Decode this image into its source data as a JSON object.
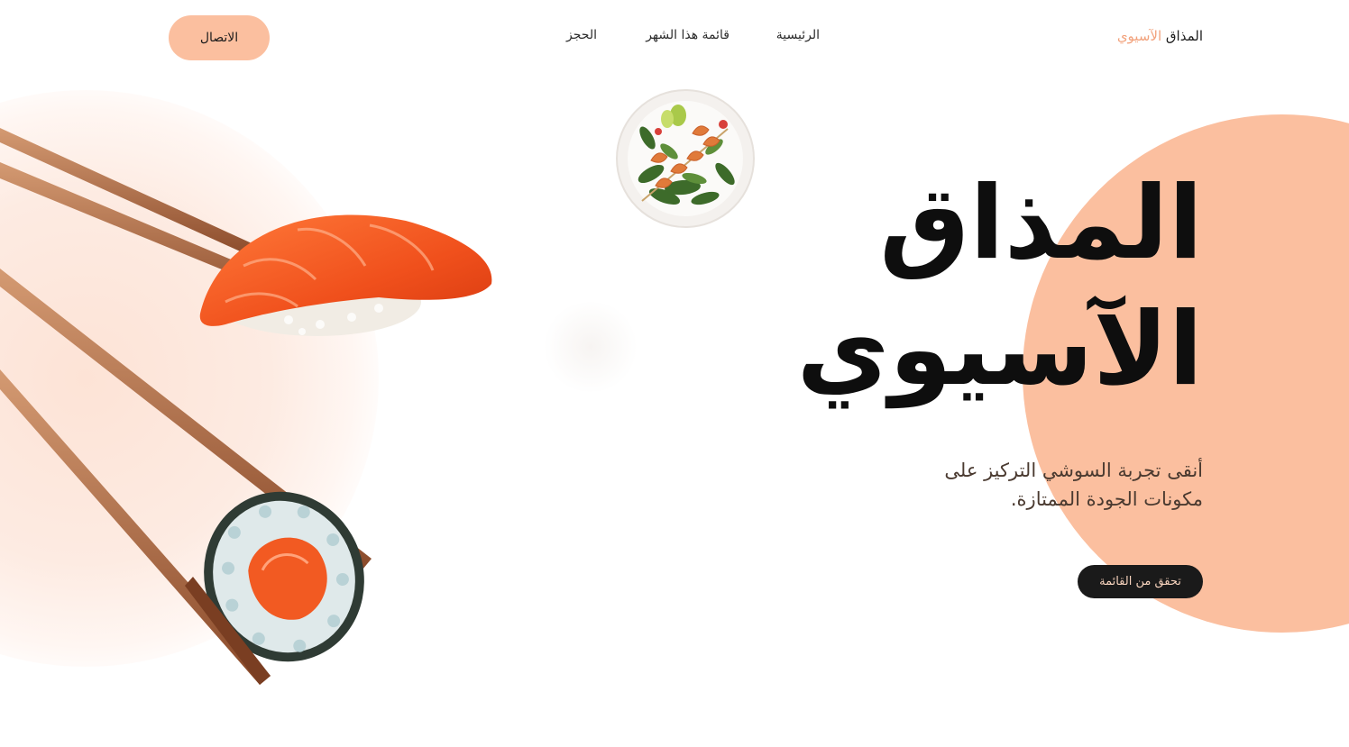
{
  "header": {
    "brand_prefix": "المذاق",
    "brand_accent": "الآسيوي",
    "nav": {
      "home": "الرئيسية",
      "menu": "قائمة هذا الشهر",
      "booking": "الحجز"
    },
    "contact_label": "الاتصال"
  },
  "hero": {
    "title_line1": "المذاق",
    "title_line2": "الآسيوي",
    "subtitle": "أنقى تجربة السوشي التركيز على مكونات الجودة الممتازة.",
    "cta_label": "تحقق من القائمة"
  },
  "images": {
    "plate": "shrimp-salad-plate",
    "sushi": "sushi-with-chopsticks"
  },
  "colors": {
    "accent": "#fbbf9f",
    "brand_accent_text": "#f2a27c",
    "cta_background": "#1a1a1a",
    "cta_text": "#f7d3bd"
  }
}
